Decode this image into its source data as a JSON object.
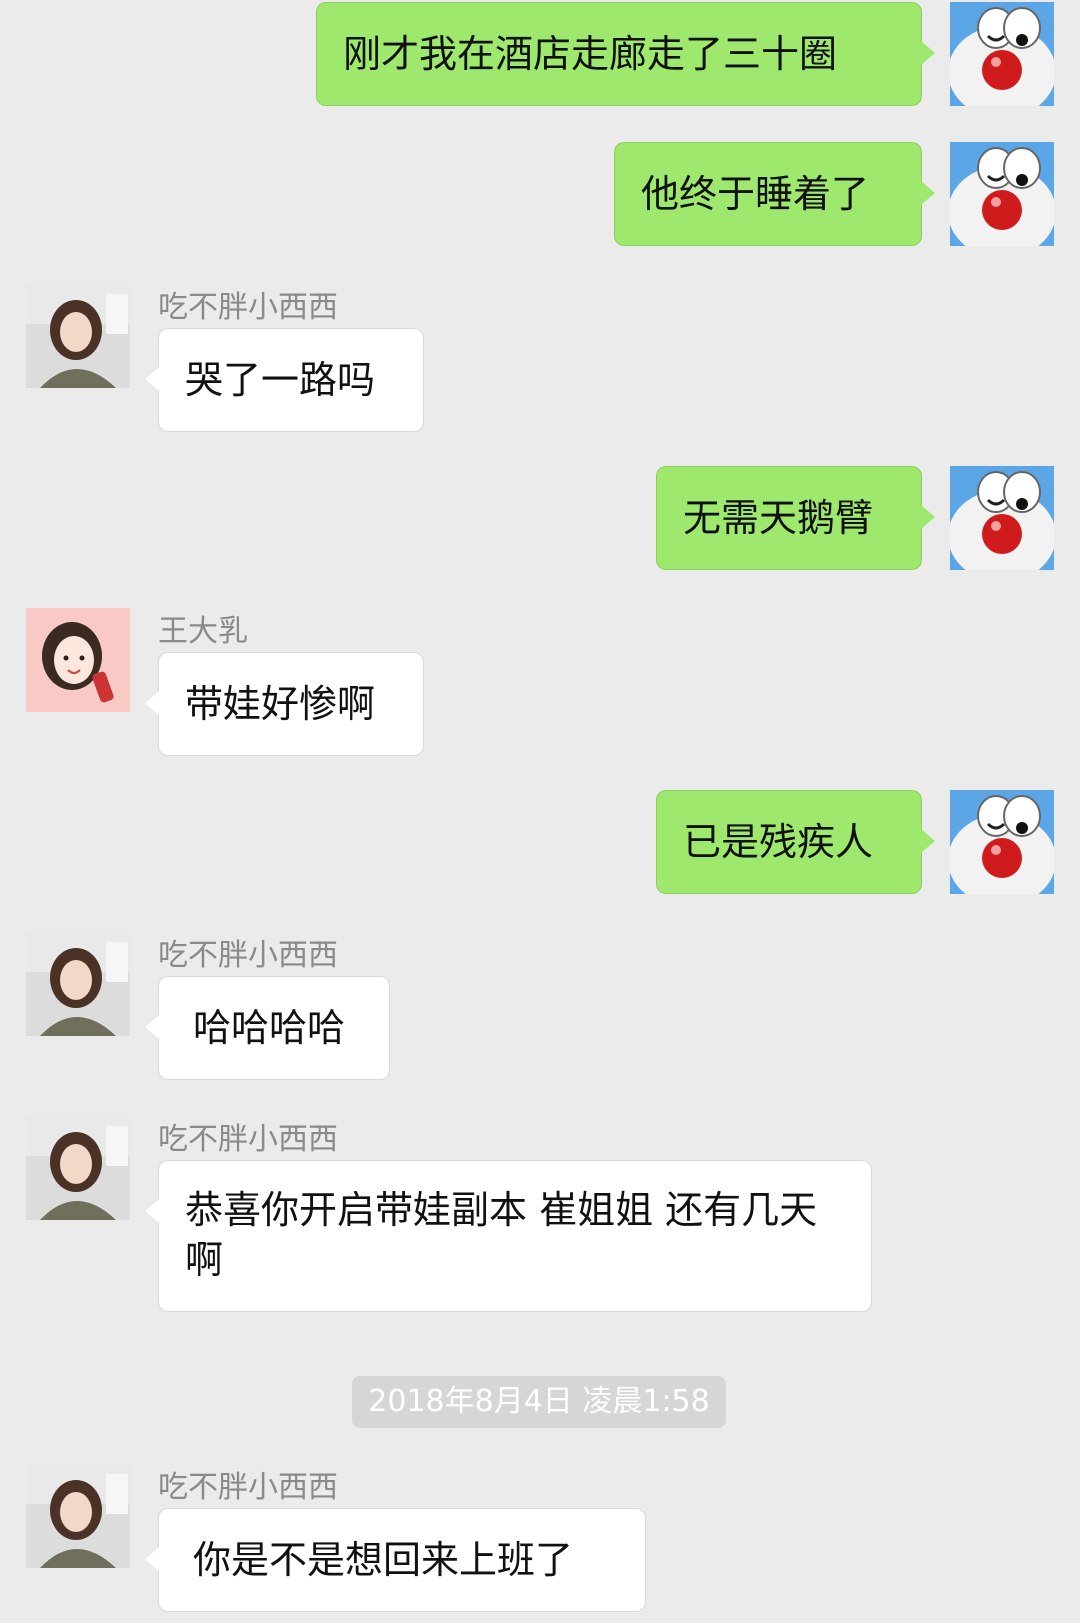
{
  "messages": [
    {
      "side": "right",
      "text": "刚才我在酒店走廊走了三十圈"
    },
    {
      "side": "right",
      "text": "他终于睡着了"
    },
    {
      "side": "left",
      "sender": "吃不胖小西西",
      "text": "哭了一路吗"
    },
    {
      "side": "right",
      "text": "无需天鹅臂"
    },
    {
      "side": "left",
      "sender": "王大乳",
      "text": "带娃好惨啊"
    },
    {
      "side": "right",
      "text": "已是残疾人"
    },
    {
      "side": "left",
      "sender": "吃不胖小西西",
      "text": "哈哈哈哈"
    },
    {
      "side": "left",
      "sender": "吃不胖小西西",
      "text": "恭喜你开启带娃副本 崔姐姐 还有几天啊"
    },
    {
      "side": "left",
      "sender": "吃不胖小西西",
      "text": "你是不是想回来上班了"
    }
  ],
  "timestamp": "2018年8月4日 凌晨1:58",
  "colors": {
    "background": "#ebebeb",
    "right_bubble": "#9ee86e",
    "left_bubble": "#ffffff"
  }
}
